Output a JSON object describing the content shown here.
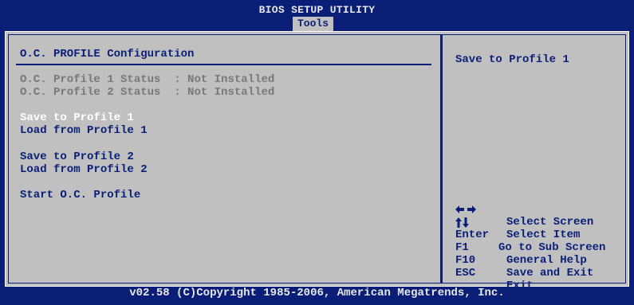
{
  "header": {
    "title": "BIOS SETUP UTILITY",
    "active_tab": "Tools"
  },
  "main": {
    "section_title": "O.C. PROFILE Configuration",
    "status_items": [
      {
        "label": "O.C. Profile 1 Status",
        "value": ": Not Installed"
      },
      {
        "label": "O.C. Profile 2 Status",
        "value": ": Not Installed"
      }
    ],
    "menu_items": [
      {
        "label": "Save to Profile 1"
      },
      {
        "label": "Load from Profile 1"
      },
      {
        "label": "Save to Profile 2"
      },
      {
        "label": "Load from Profile 2"
      },
      {
        "label": "Start O.C. Profile"
      }
    ]
  },
  "help": {
    "text": "Save to Profile 1",
    "keys": [
      {
        "key_icon": "left-right-arrow-icon",
        "desc": "Select Screen"
      },
      {
        "key_icon": "up-down-arrow-icon",
        "desc": "Select Item"
      },
      {
        "key": "Enter",
        "desc": "Go to Sub Screen"
      },
      {
        "key": "F1",
        "desc": "General Help"
      },
      {
        "key": "F10",
        "desc": "Save and Exit"
      },
      {
        "key": "ESC",
        "desc": "Exit"
      }
    ]
  },
  "footer": {
    "copyright": "v02.58 (C)Copyright 1985-2006, American Megatrends, Inc."
  },
  "colors": {
    "background": "#0a1e78",
    "panel": "#c0c0c0",
    "text": "#0a1e78",
    "disabled": "#787878",
    "highlight": "#ffffff"
  }
}
